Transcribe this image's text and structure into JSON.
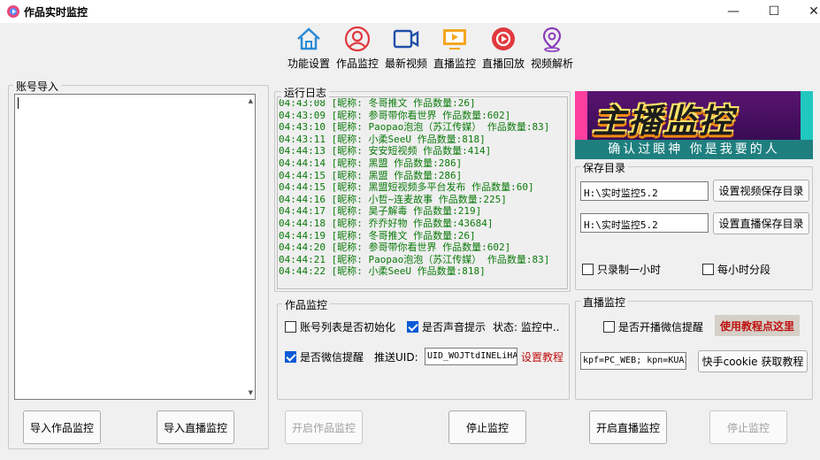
{
  "window": {
    "title": "作品实时监控",
    "minimize": "—",
    "maximize": "☐",
    "close": "✕"
  },
  "toolbar": [
    {
      "label": "功能设置",
      "icon": "home-icon"
    },
    {
      "label": "作品监控",
      "icon": "user-icon"
    },
    {
      "label": "最新视频",
      "icon": "video-icon"
    },
    {
      "label": "直播监控",
      "icon": "tv-play-icon"
    },
    {
      "label": "直播回放",
      "icon": "replay-icon"
    },
    {
      "label": "视频解析",
      "icon": "location-icon"
    }
  ],
  "accounts": {
    "label": "账号导入",
    "import_works_button": "导入作品监控",
    "import_live_button": "导入直播监控"
  },
  "log": {
    "label": "运行日志",
    "lines": [
      "04:43:08 [昵称: 冬哥推文  作品数量:26]",
      "04:43:09 [昵称: 参哥带你看世界  作品数量:602]",
      "04:43:10 [昵称: Paopao泡泡（苏江传媒）  作品数量:83]",
      "04:43:11 [昵称: 小柔SeeU  作品数量:818]",
      "04:44:13 [昵称: 安安短视频  作品数量:414]",
      "04:44:14 [昵称: 黑盟  作品数量:286]",
      "04:44:15 [昵称: 黑盟  作品数量:286]",
      "04:44:15 [昵称: 黑盟短视频多平台发布  作品数量:60]",
      "04:44:16 [昵称: 小哲~连麦故事  作品数量:225]",
      "04:44:17 [昵称: 昊子解毒  作品数量:219]",
      "04:44:18 [昵称: 乔乔好物  作品数量:43684]",
      "04:44:19 [昵称: 冬哥推文  作品数量:26]",
      "04:44:20 [昵称: 参哥带你看世界  作品数量:602]",
      "04:44:21 [昵称: Paopao泡泡（苏江传媒）  作品数量:83]",
      "04:44:22 [昵称: 小柔SeeU  作品数量:818]"
    ]
  },
  "banner": {
    "title": "主播监控",
    "subtitle": "确认过眼神 你是我要的人"
  },
  "save_dir": {
    "label": "保存目录",
    "video_path": "H:\\实时监控5.2",
    "video_button": "设置视频保存目录",
    "live_path": "H:\\实时监控5.2",
    "live_button": "设置直播保存目录",
    "record_one_hour": "只录制一小时",
    "segment_hourly": "每小时分段"
  },
  "works_monitor": {
    "label": "作品监控",
    "init_checkbox": "账号列表是否初始化",
    "sound_checkbox": "是否声音提示",
    "status_text": "状态: 监控中..",
    "wechat_checkbox": "是否微信提醒",
    "push_uid_label": "推送UID:",
    "push_uid_value": "UID_WOJTtdINELiHA",
    "setup_tutorial_link": "设置教程"
  },
  "live_monitor": {
    "label": "直播监控",
    "wechat_checkbox": "是否开播微信提醒",
    "tutorial_button": "使用教程点这里",
    "cookie_value": "kpf=PC_WEB; kpn=KUAI",
    "cookie_button": "快手cookie 获取教程"
  },
  "bottom": {
    "start_works": "开启作品监控",
    "stop_works": "停止监控",
    "start_live": "开启直播监控",
    "stop_live": "停止监控"
  },
  "colors": {
    "log_text": "#0b7a0b",
    "checkbox_on": "#0a5bd6",
    "link_red": "#c01010"
  }
}
